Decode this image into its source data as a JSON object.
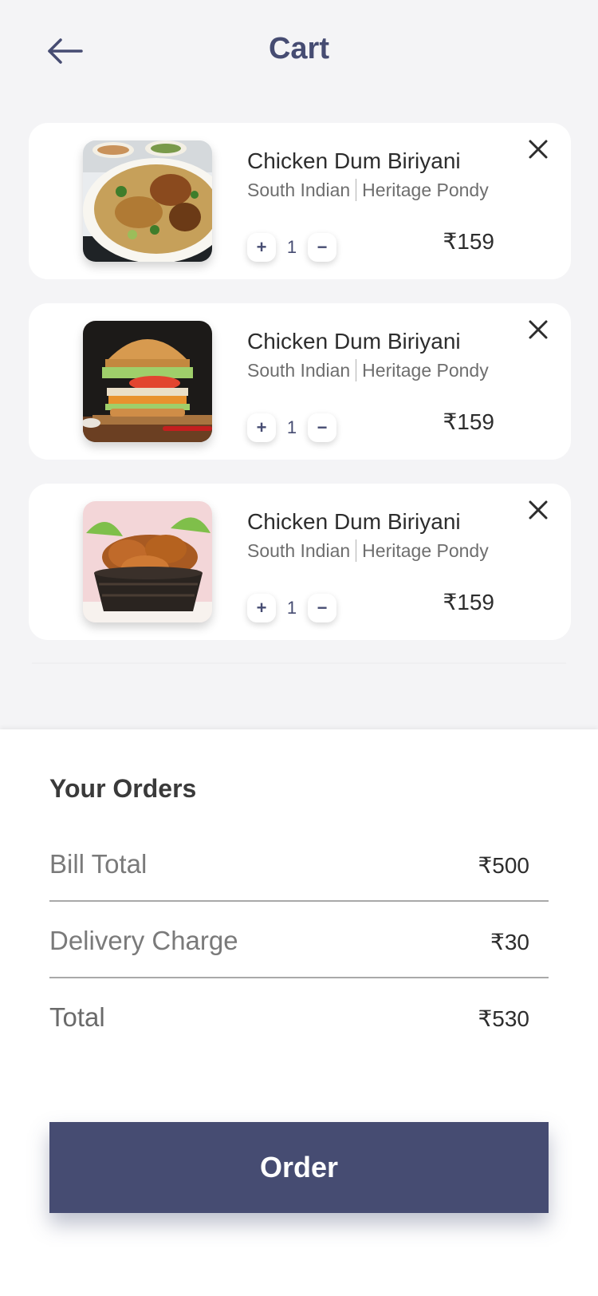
{
  "header": {
    "title": "Cart",
    "back_icon": "arrow-left-icon"
  },
  "cart": {
    "items": [
      {
        "name": "Chicken Dum Biriyani",
        "cuisine": "South Indian",
        "restaurant": "Heritage Pondy",
        "quantity": "1",
        "price": "₹159",
        "image": "biryani-plate-image"
      },
      {
        "name": "Chicken Dum Biriyani",
        "cuisine": "South Indian",
        "restaurant": "Heritage Pondy",
        "quantity": "1",
        "price": "₹159",
        "image": "burger-image"
      },
      {
        "name": "Chicken Dum Biriyani",
        "cuisine": "South Indian",
        "restaurant": "Heritage Pondy",
        "quantity": "1",
        "price": "₹159",
        "image": "fried-chicken-basket-image"
      }
    ],
    "increment_label": "+",
    "decrement_label": "−"
  },
  "summary": {
    "title": "Your Orders",
    "bill_total_label": "Bill Total",
    "bill_total_value": "₹500",
    "delivery_label": "Delivery Charge",
    "delivery_value": "₹30",
    "total_label": "Total",
    "total_value": "₹530"
  },
  "actions": {
    "order_label": "Order"
  },
  "colors": {
    "accent": "#464c72",
    "background": "#f4f4f6",
    "card": "#ffffff"
  }
}
